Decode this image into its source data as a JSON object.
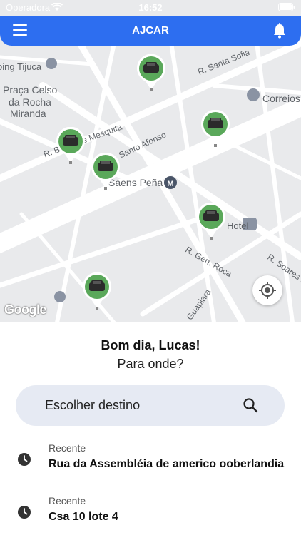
{
  "status": {
    "carrier": "Operadora",
    "time": "16:52"
  },
  "header": {
    "title": "AJCAR"
  },
  "map": {
    "labels": {
      "tijuca": "oing Tijuca",
      "praca1": "Praça Celso",
      "praca2": "da Rocha",
      "praca3": "Miranda",
      "santa_sofia": "R. Santa Sofia",
      "correios": "Correios",
      "mesquita": "R. Barão de Mesquita",
      "santo_afonso": "Santo Afonso",
      "saens_pena": "Saens Peña",
      "hotel": "Hotel",
      "gen_roca": "R. Gen. Roca",
      "soares": "R. Soares da",
      "guapiara": "Guapiara"
    },
    "attribution": "Google"
  },
  "panel": {
    "greeting": "Bom dia, Lucas!",
    "subtitle": "Para onde?",
    "search_label": "Escolher destino",
    "recents": [
      {
        "label": "Recente",
        "address": "Rua da Assembléia de americo ooberlandia"
      },
      {
        "label": "Recente",
        "address": "Csa 10 lote 4"
      }
    ]
  },
  "colors": {
    "primary": "#2d6ef0",
    "car_marker": "#5aa85a"
  }
}
